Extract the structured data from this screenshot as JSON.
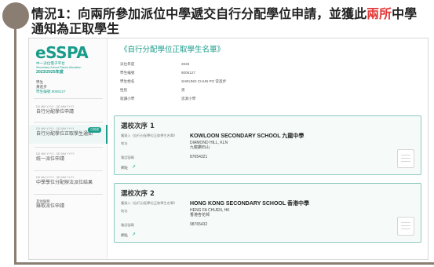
{
  "slide": {
    "title_part1": "情況1：向兩所參加派位中學遞交自行分配學位申請，並獲此",
    "title_highlight": "兩所",
    "title_part2": "中學通知為正取學生"
  },
  "sidebar": {
    "logo": "eSSPA",
    "subtitle1": "中一派位電子平台",
    "subtitle2": "Secondary School Places Allocation",
    "year": "2023/2025年度",
    "user_label": "學生",
    "user_name": "黃進步",
    "user_link": "學生編號 8006127",
    "items": [
      {
        "date": "DD MM YYYY - DD MM YYYY",
        "label": "自行分配學位申請"
      },
      {
        "date": "DD MM YYYY - DD MM YYYY",
        "label": "自行分配學位正取學生通知",
        "badge": "已完成"
      },
      {
        "date": "DD MM YYYY - DD MM YYYY",
        "label": "統一派位申請"
      },
      {
        "date": "DD MM YYYY - DD MM YYYY",
        "label": "中學學位分配辦法派位結果"
      },
      {
        "date": "其他服務",
        "label": "錄取派位申請"
      }
    ]
  },
  "main": {
    "title": "《自行分配學位正取學生名單》",
    "info": [
      {
        "k": "派位年度",
        "v": "2025"
      },
      {
        "k": "學生編號",
        "v": "8006127"
      },
      {
        "k": "學生姓名",
        "v": "SHEUNG CHUN PO 常進步"
      },
      {
        "k": "性別",
        "v": "男"
      },
      {
        "k": "就讀小學",
        "v": "思源小學"
      }
    ],
    "cards": [
      {
        "title": "選校次序 1",
        "school_label": "獲錄入《自行分配學位正取學生名單》",
        "school": "KOWLOON SECONDARY SCHOOL 九龍中學",
        "address_label": "地址",
        "address1": "DIAMOND HILL, KLN",
        "address2": "九龍鑽石山",
        "phone_label": "電話號碼",
        "phone": "87654321",
        "map": "網址"
      },
      {
        "title": "選校次序 2",
        "school_label": "獲錄入《自行分配學位正取學生名單》",
        "school": "HONG KONG SECONDARY SCHOOL 香港中學",
        "address_label": "地址",
        "address1": "HENG FA CHUEN, HK",
        "address2": "香港杏花邨",
        "phone_label": "電話號碼",
        "phone": "98765432",
        "map": "網址"
      }
    ]
  }
}
